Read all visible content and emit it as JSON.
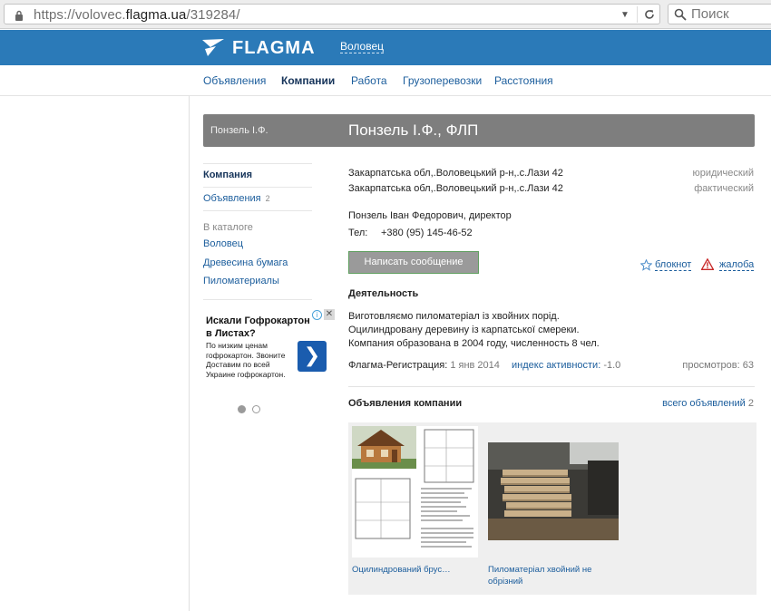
{
  "browser": {
    "url_prefix": "https://volovec.",
    "url_domain": "flagma.ua",
    "url_path": "/319284/",
    "search_placeholder": "Поиск"
  },
  "header": {
    "logo": "FLAGMA",
    "city": "Воловец"
  },
  "nav": {
    "items": [
      "Объявления",
      "Компании",
      "Работа",
      "Грузоперевозки",
      "Расстояния"
    ],
    "active": "Компании"
  },
  "title_bar": {
    "crumb": "Понзель І.Ф.",
    "title": "Понзель І.Ф., ФЛП"
  },
  "sidebar": {
    "company": "Компания",
    "ads": "Объявления",
    "ads_count": "2",
    "catalog_label": "В каталоге",
    "catalog_items": [
      "Воловец",
      "Древесина бумага",
      "Пиломатериалы"
    ]
  },
  "ad": {
    "title": "Искали Гофрокартон в Листах?",
    "text": "По низким ценам гофрокартон. Звоните Доставим по всей Украине гофрокартон.",
    "arrow": "❯"
  },
  "company": {
    "address_legal": "Закарпатська обл,.Воловецький р-н,.с.Лази 42",
    "address_legal_type": "юридический",
    "address_actual": "Закарпатська обл,.Воловецький р-н,.с.Лази 42",
    "address_actual_type": "фактический",
    "contact_person": "Понзель Іван Федорович, директор",
    "phone_label": "Тел:",
    "phone": "+380 (95) 145-46-52",
    "message_button": "Написать сообщение",
    "notebook": "блокнот",
    "complaint": "жалоба",
    "activity_title": "Деятельность",
    "activity_lines": [
      "Виготовляємо пиломатеріал із хвойних порід.",
      "Оцилиндровану деревину із карпатської смереки.",
      "Компания образована в 2004 году, численность 8 чел."
    ],
    "registration_label": "Флагма-Регистрация:",
    "registration_date": "1 янв 2014",
    "activity_index_label": "индекс активности:",
    "activity_index_value": "-1.0",
    "views_label": "просмотров:",
    "views": "63"
  },
  "listings": {
    "title": "Объявления компании",
    "all_label": "всего объявлений",
    "all_count": "2",
    "items": [
      {
        "caption": "Оцилиндрований брус…"
      },
      {
        "caption": "Пиломатеріал хвойний не обрізний"
      }
    ]
  },
  "colors": {
    "brand_blue": "#2b7ab8",
    "link_blue": "#1b5d9c",
    "title_bar_gray": "#7e7e7e"
  }
}
